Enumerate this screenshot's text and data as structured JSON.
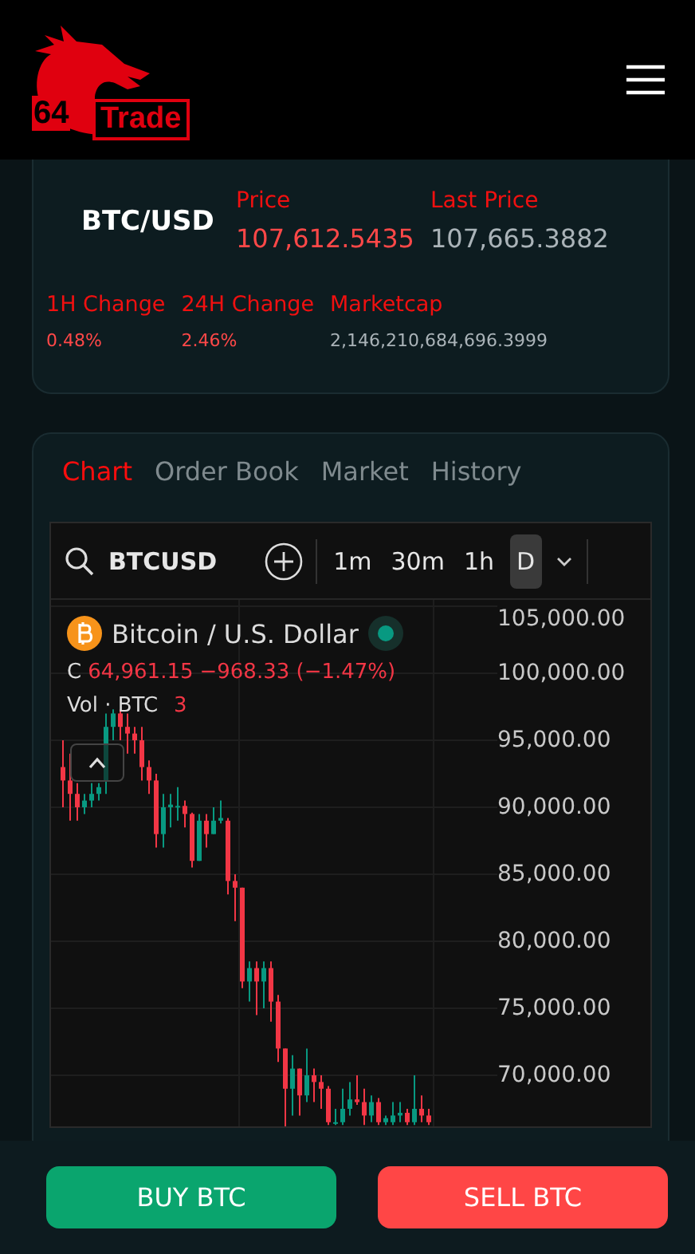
{
  "header": {
    "logo": {
      "number": "64",
      "name": "Trade"
    }
  },
  "ticker": {
    "pair": "BTC/USD",
    "prices": [
      {
        "label": "Price",
        "value": "107,612.5435",
        "kind": "accent"
      },
      {
        "label": "Last Price",
        "value": "107,665.3882",
        "kind": "plain"
      }
    ],
    "stats": [
      {
        "label": "1H Change",
        "value": "0.48%",
        "kind": "accent"
      },
      {
        "label": "24H Change",
        "value": "2.46%",
        "kind": "accent"
      },
      {
        "label": "Marketcap",
        "value": "2,146,210,684,696.3999",
        "kind": "plain"
      }
    ]
  },
  "tabs": [
    {
      "label": "Chart",
      "selected": true
    },
    {
      "label": "Order Book",
      "selected": false
    },
    {
      "label": "Market",
      "selected": false
    },
    {
      "label": "History",
      "selected": false
    }
  ],
  "chart_widget": {
    "symbol": "BTCUSD",
    "intervals": [
      {
        "label": "1m",
        "selected": false
      },
      {
        "label": "30m",
        "selected": false
      },
      {
        "label": "1h",
        "selected": false
      },
      {
        "label": "D",
        "selected": true
      }
    ],
    "legend": {
      "title": "Bitcoin / U.S. Dollar",
      "market_open": true,
      "close_label": "C",
      "close": "64,961.15",
      "change": "−968.33 (−1.47%)",
      "volume_label": "Vol · BTC",
      "volume": "3"
    },
    "chart_data": {
      "type": "candlestick",
      "grid": true,
      "ohlc": [
        [
          93000,
          95000,
          90000,
          92000
        ],
        [
          92000,
          94000,
          89000,
          91000
        ],
        [
          91000,
          91800,
          89000,
          90000
        ],
        [
          90000,
          91000,
          89500,
          90500
        ],
        [
          90500,
          91800,
          90000,
          91000
        ],
        [
          91000,
          91800,
          90500,
          91500
        ],
        [
          92000,
          97000,
          91000,
          96000
        ],
        [
          96000,
          97300,
          95000,
          97000
        ],
        [
          97000,
          97300,
          95000,
          96000
        ],
        [
          96000,
          97000,
          94000,
          95500
        ],
        [
          95500,
          96000,
          94000,
          95000
        ],
        [
          95000,
          96000,
          92000,
          93000
        ],
        [
          93000,
          93500,
          91000,
          92000
        ],
        [
          92000,
          92500,
          87000,
          88000
        ],
        [
          88000,
          91000,
          87000,
          90000
        ],
        [
          90000,
          91000,
          88500,
          90200
        ],
        [
          90000,
          91500,
          89000,
          90100
        ],
        [
          90100,
          90500,
          88500,
          89500
        ],
        [
          89500,
          89600,
          85500,
          86000
        ],
        [
          86000,
          89500,
          86000,
          89000
        ],
        [
          89000,
          89500,
          87000,
          88000
        ],
        [
          88000,
          90000,
          88000,
          89000
        ],
        [
          89000,
          90500,
          88800,
          89200
        ],
        [
          89000,
          89200,
          83500,
          84500
        ],
        [
          84500,
          85000,
          81500,
          84000
        ],
        [
          84000,
          84000,
          76500,
          77000
        ],
        [
          77000,
          78500,
          75500,
          78000
        ],
        [
          78000,
          78500,
          74500,
          77000
        ],
        [
          77000,
          78500,
          75000,
          78000
        ],
        [
          78000,
          78500,
          74000,
          75500
        ],
        [
          75500,
          76000,
          71000,
          72000
        ],
        [
          72000,
          72000,
          66000,
          69000
        ],
        [
          69000,
          71500,
          67000,
          70500
        ],
        [
          70500,
          70500,
          67000,
          68500
        ],
        [
          68500,
          72000,
          68000,
          70000
        ],
        [
          70000,
          70500,
          68000,
          69500
        ],
        [
          69500,
          70000,
          67500,
          69000
        ],
        [
          69000,
          69200,
          66300,
          66500
        ],
        [
          66500,
          67500,
          66300,
          66500
        ],
        [
          66500,
          69000,
          66300,
          67500
        ],
        [
          67500,
          69500,
          67000,
          68200
        ],
        [
          68200,
          70000,
          67800,
          68000
        ],
        [
          68000,
          69000,
          66300,
          67000
        ],
        [
          67000,
          68500,
          66500,
          68000
        ],
        [
          68000,
          68300,
          66300,
          66500
        ],
        [
          66500,
          67000,
          66300,
          66800
        ],
        [
          66500,
          68000,
          66300,
          67000
        ],
        [
          67000,
          68000,
          66500,
          67200
        ],
        [
          67200,
          67500,
          66300,
          66500
        ],
        [
          66500,
          70000,
          66300,
          67500
        ],
        [
          67500,
          68500,
          66500,
          67000
        ],
        [
          67000,
          67500,
          66300,
          66500
        ]
      ],
      "ylim": [
        66190,
        105476
      ],
      "yticks": [
        {
          "value": 105000,
          "label": "105,000.00"
        },
        {
          "value": 100000,
          "label": "100,000.00"
        },
        {
          "value": 95000,
          "label": "95,000.00"
        },
        {
          "value": 90000,
          "label": "90,000.00"
        },
        {
          "value": 85000,
          "label": "85,000.00"
        },
        {
          "value": 80000,
          "label": "80,000.00"
        },
        {
          "value": 75000,
          "label": "75,000.00"
        },
        {
          "value": 70000,
          "label": "70,000.00"
        }
      ]
    }
  },
  "actions": [
    {
      "label": "BUY BTC",
      "kind": "buy"
    },
    {
      "label": "SELL BTC",
      "kind": "sell"
    }
  ]
}
